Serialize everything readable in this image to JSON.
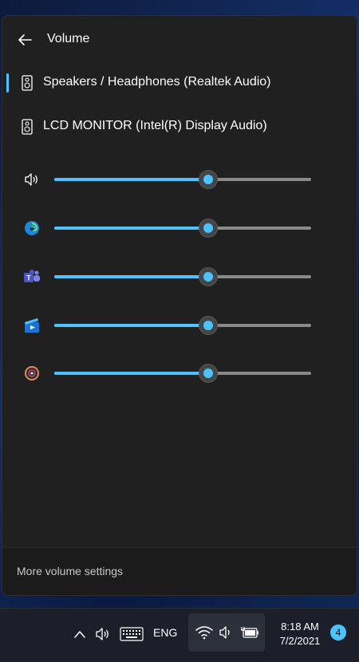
{
  "panel": {
    "title": "Volume",
    "back_icon": "arrow-left-icon",
    "devices": [
      {
        "label": "Speakers / Headphones (Realtek Audio)",
        "icon": "speaker-icon",
        "selected": true
      },
      {
        "label": "LCD MONITOR (Intel(R) Display Audio)",
        "icon": "speaker-icon",
        "selected": false
      }
    ],
    "sliders": [
      {
        "icon": "volume-icon",
        "level": 0.6
      },
      {
        "icon": "edge-icon",
        "level": 0.6
      },
      {
        "icon": "teams-icon",
        "level": 0.6
      },
      {
        "icon": "movies-tv-icon",
        "level": 0.6
      },
      {
        "icon": "media-player-icon",
        "level": 0.6
      }
    ],
    "footer_link": "More volume settings"
  },
  "taskbar": {
    "language": "ENG",
    "time": "8:18 AM",
    "date": "7/2/2021",
    "notification_count": "4"
  },
  "colors": {
    "accent": "#4cc2ff",
    "panel_bg": "#202020",
    "track": "#8a8a8a"
  }
}
